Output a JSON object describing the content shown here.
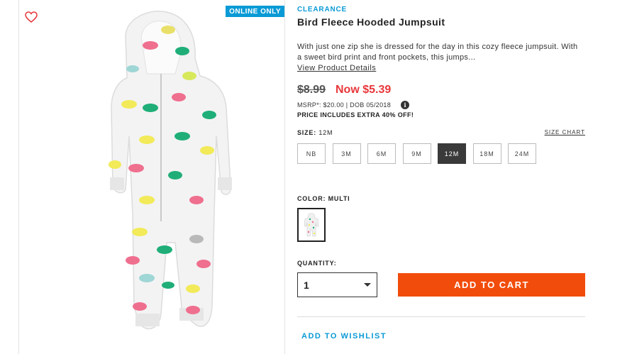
{
  "badge": "ONLINE ONLY",
  "product": {
    "tag": "CLEARANCE",
    "title": "Bird Fleece Hooded Jumpsuit",
    "description": "With just one zip she is dressed for the day in this cozy fleece jumpsuit. With a sweet bird print and front pockets, this jumps...",
    "view_details": "View Product Details"
  },
  "price": {
    "old": "$8.99",
    "now": "Now $5.39",
    "msrp": "MSRP*: $20.00 | DOB 05/2018",
    "extra_off": "PRICE INCLUDES EXTRA 40% OFF!"
  },
  "size": {
    "label": "SIZE:",
    "selected": "12M",
    "chart_link": "SIZE CHART",
    "options": [
      "NB",
      "3M",
      "6M",
      "9M",
      "12M",
      "18M",
      "24M"
    ],
    "selected_index": 4
  },
  "color": {
    "label": "COLOR: MULTI"
  },
  "quantity": {
    "label": "QUANTITY:",
    "value": "1"
  },
  "actions": {
    "add_to_cart": "ADD TO CART",
    "add_to_wishlist": "ADD TO WISHLIST"
  },
  "icons": {
    "heart": "heart-icon",
    "info": "info-icon",
    "caret": "chevron-down-icon"
  },
  "colors": {
    "accent_blue": "#0a9ad6",
    "sale_red": "#e8363a",
    "cart_orange": "#f24c0c"
  }
}
